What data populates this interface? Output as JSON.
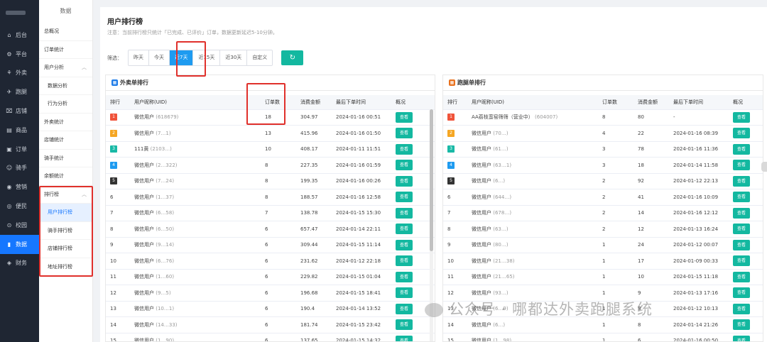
{
  "nav": {
    "items": [
      {
        "icon": "home-icon",
        "glyph": "⌂",
        "label": "后台",
        "active": false
      },
      {
        "icon": "gear-icon",
        "glyph": "⚙",
        "label": "平台",
        "active": false
      },
      {
        "icon": "takeout-icon",
        "glyph": "⚘",
        "label": "外卖",
        "active": false
      },
      {
        "icon": "run-icon",
        "glyph": "✈",
        "label": "跑腿",
        "active": false
      },
      {
        "icon": "store-icon",
        "glyph": "⌧",
        "label": "店铺",
        "active": false
      },
      {
        "icon": "goods-icon",
        "glyph": "▤",
        "label": "商品",
        "active": false
      },
      {
        "icon": "order-icon",
        "glyph": "▣",
        "label": "订单",
        "active": false
      },
      {
        "icon": "rider-icon",
        "glyph": "☺",
        "label": "骑手",
        "active": false
      },
      {
        "icon": "marketing-icon",
        "glyph": "◉",
        "label": "营销",
        "active": false
      },
      {
        "icon": "convenience-icon",
        "glyph": "◎",
        "label": "便民",
        "active": false
      },
      {
        "icon": "campus-icon",
        "glyph": "⊙",
        "label": "校园",
        "active": false
      },
      {
        "icon": "data-icon",
        "glyph": "▮",
        "label": "数据",
        "active": true
      },
      {
        "icon": "finance-icon",
        "glyph": "◈",
        "label": "财务",
        "active": false
      }
    ]
  },
  "submenu": {
    "header": "数据",
    "items": [
      {
        "label": "总概况",
        "type": "item"
      },
      {
        "label": "订单统计",
        "type": "item"
      },
      {
        "label": "用户分析",
        "type": "group",
        "chevron": "︿"
      },
      {
        "label": "数据分析",
        "type": "child"
      },
      {
        "label": "行为分析",
        "type": "child"
      },
      {
        "label": "外卖统计",
        "type": "item"
      },
      {
        "label": "店铺统计",
        "type": "item"
      },
      {
        "label": "骑手统计",
        "type": "item"
      },
      {
        "label": "余额统计",
        "type": "item"
      },
      {
        "label": "排行榜",
        "type": "group",
        "chevron": "︿"
      },
      {
        "label": "用户排行榜",
        "type": "child",
        "selected": true
      },
      {
        "label": "骑手排行榜",
        "type": "child"
      },
      {
        "label": "店铺排行榜",
        "type": "child"
      },
      {
        "label": "地址排行榜",
        "type": "child"
      }
    ]
  },
  "page": {
    "title": "用户排行榜",
    "note": "注意：当前排行榜只统计「已完成、已评价」订单，数据更新延迟5-10分钟。",
    "filter_label": "筛选：",
    "filters": [
      "昨天",
      "今天",
      "近7天",
      "近15天",
      "近30天",
      "自定义"
    ],
    "active_filter": 2,
    "refresh_glyph": "↻"
  },
  "takeout_panel": {
    "title": "外卖单排行",
    "icon": "takeout-rank-icon",
    "columns": [
      "排行",
      "用户昵称(UID)",
      "订单数",
      "消费金额",
      "最后下单时间",
      "概况"
    ],
    "view_label": "查看",
    "rows": [
      [
        "1",
        "微信用户",
        "(618679)",
        "18",
        "304.97",
        "2024-01-16 00:51"
      ],
      [
        "2",
        "微信用户",
        "(7…1)",
        "13",
        "415.96",
        "2024-01-16 01:50"
      ],
      [
        "3",
        "111黄",
        "(2103…)",
        "10",
        "408.17",
        "2024-01-11 11:51"
      ],
      [
        "4",
        "微信用户",
        "(2…322)",
        "8",
        "227.35",
        "2024-01-16 01:59"
      ],
      [
        "5",
        "微信用户",
        "(7…24)",
        "8",
        "199.35",
        "2024-01-16 00:26"
      ],
      [
        "6",
        "微信用户",
        "(1…37)",
        "8",
        "188.57",
        "2024-01-16 12:58"
      ],
      [
        "7",
        "微信用户",
        "(6…58)",
        "7",
        "138.78",
        "2024-01-15 15:30"
      ],
      [
        "8",
        "微信用户",
        "(6…50)",
        "6",
        "657.47",
        "2024-01-14 22:11"
      ],
      [
        "9",
        "微信用户",
        "(9…14)",
        "6",
        "309.44",
        "2024-01-15 11:14"
      ],
      [
        "10",
        "微信用户",
        "(6…76)",
        "6",
        "231.62",
        "2024-01-12 22:18"
      ],
      [
        "11",
        "微信用户",
        "(1…60)",
        "6",
        "229.82",
        "2024-01-15 01:04"
      ],
      [
        "12",
        "微信用户",
        "(9…5)",
        "6",
        "196.68",
        "2024-01-15 18:41"
      ],
      [
        "13",
        "微信用户",
        "(10…1)",
        "6",
        "190.4",
        "2024-01-14 13:52"
      ],
      [
        "14",
        "微信用户",
        "(14…33)",
        "6",
        "181.74",
        "2024-01-15 23:42"
      ],
      [
        "15",
        "微信用户",
        "(1…90)",
        "6",
        "137.65",
        "2024-01-15 14:32"
      ]
    ]
  },
  "errand_panel": {
    "title": "跑腿单排行",
    "icon": "errand-rank-icon",
    "columns": [
      "排行",
      "用户昵称(UID)",
      "订单数",
      "消费金额",
      "最后下单时间",
      "概况"
    ],
    "view_label": "查看",
    "rows": [
      [
        "1",
        "AA荔枝蛮窑筛筛（营业中）",
        "(604007)",
        "8",
        "80",
        "-"
      ],
      [
        "2",
        "微信用户",
        "(70…)",
        "4",
        "22",
        "2024-01-16 08:39"
      ],
      [
        "3",
        "微信用户",
        "(61…)",
        "3",
        "78",
        "2024-01-16 11:36"
      ],
      [
        "4",
        "微信用户",
        "(63…1)",
        "3",
        "18",
        "2024-01-14 11:58"
      ],
      [
        "5",
        "微信用户",
        "(6…)",
        "2",
        "92",
        "2024-01-12 22:13"
      ],
      [
        "6",
        "微信用户",
        "(644…)",
        "2",
        "41",
        "2024-01-16 10:09"
      ],
      [
        "7",
        "微信用户",
        "(678…)",
        "2",
        "14",
        "2024-01-16 12:12"
      ],
      [
        "8",
        "微信用户",
        "(63…)",
        "2",
        "12",
        "2024-01-13 16:24"
      ],
      [
        "9",
        "微信用户",
        "(80…)",
        "1",
        "24",
        "2024-01-12 00:07"
      ],
      [
        "10",
        "微信用户",
        "(21…38)",
        "1",
        "17",
        "2024-01-09 00:33"
      ],
      [
        "11",
        "微信用户",
        "(21…65)",
        "1",
        "10",
        "2024-01-15 11:18"
      ],
      [
        "12",
        "微信用户",
        "(93…)",
        "1",
        "9",
        "2024-01-13 17:16"
      ],
      [
        "13",
        "微信用户",
        "(6…9)",
        "1",
        "8",
        "2024-01-12 10:13"
      ],
      [
        "14",
        "微信用户",
        "(6…)",
        "1",
        "8",
        "2024-01-14 21:26"
      ],
      [
        "15",
        "微信用户",
        "(1…98)",
        "1",
        "6",
        "2024-01-16 00:50"
      ]
    ]
  },
  "watermark": "公众号 · 哪都达外卖跑腿系统"
}
